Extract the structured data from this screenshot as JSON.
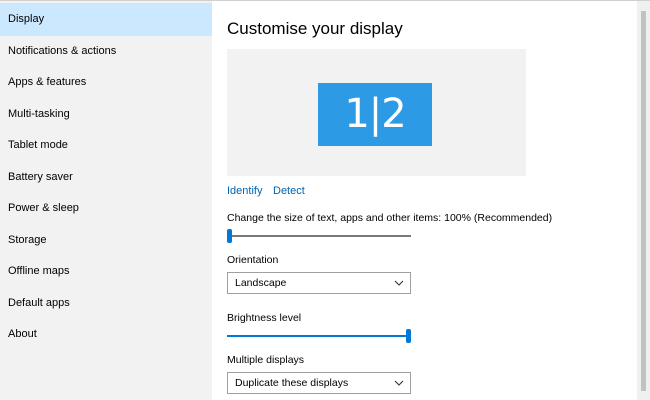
{
  "sidebar": {
    "items": [
      {
        "label": "Display",
        "active": true
      },
      {
        "label": "Notifications & actions"
      },
      {
        "label": "Apps & features"
      },
      {
        "label": "Multi-tasking"
      },
      {
        "label": "Tablet mode"
      },
      {
        "label": "Battery saver"
      },
      {
        "label": "Power & sleep"
      },
      {
        "label": "Storage"
      },
      {
        "label": "Offline maps"
      },
      {
        "label": "Default apps"
      },
      {
        "label": "About"
      }
    ]
  },
  "main": {
    "title": "Customise your display",
    "monitor_label": "1|2",
    "identify_link": "Identify",
    "detect_link": "Detect",
    "scale_label": "Change the size of text, apps and other items: 100% (Recommended)",
    "scale_slider_fraction": 0.0,
    "orientation_label": "Orientation",
    "orientation_value": "Landscape",
    "brightness_label": "Brightness level",
    "brightness_fraction": 1.0,
    "multiple_displays_label": "Multiple displays",
    "multiple_displays_value": "Duplicate these displays"
  },
  "colors": {
    "accent": "#0078d7",
    "monitor": "#2d9ae6",
    "sidebar_bg": "#f2f2f2",
    "active_item_bg": "#cce8ff",
    "link": "#0063b1"
  }
}
